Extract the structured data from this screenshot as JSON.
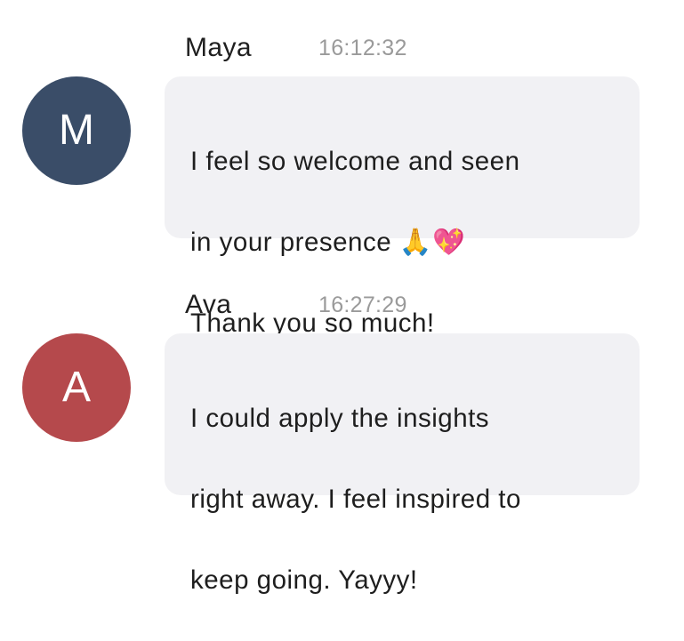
{
  "messages": [
    {
      "sender": "Maya",
      "time": "16:12:32",
      "avatar_letter": "M",
      "avatar_color": "#3a4d68",
      "text_line1": "I feel so welcome and seen",
      "text_line2": "in your presence ",
      "emojis": "🙏💖",
      "text_line3": "Thank you so much!"
    },
    {
      "sender": "Ava",
      "time": "16:27:29",
      "avatar_letter": "A",
      "avatar_color": "#b5494c",
      "text_line1": "I could apply the insights",
      "text_line2": "right away. I feel inspired to",
      "text_line3": "keep going. Yayyy!"
    }
  ]
}
